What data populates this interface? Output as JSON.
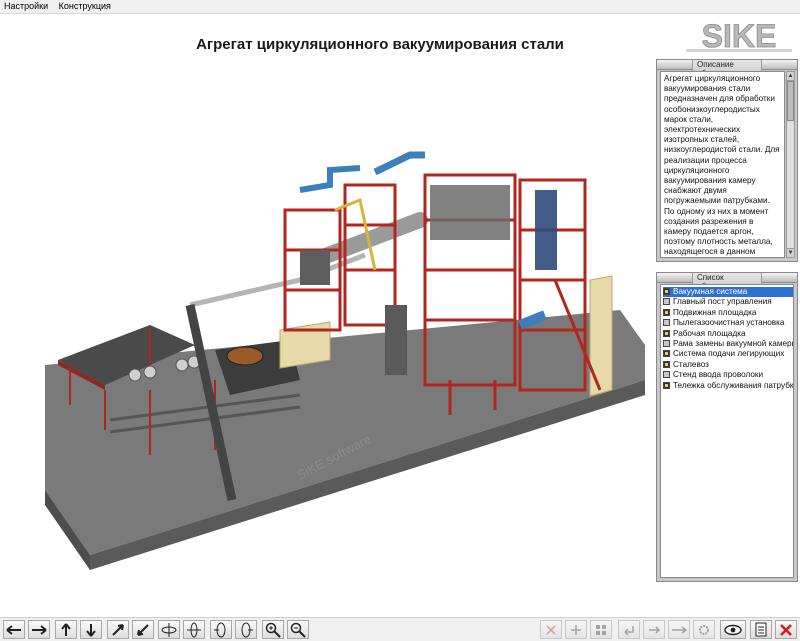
{
  "menu": {
    "items": [
      "Настройки",
      "Конструкция"
    ]
  },
  "header": {
    "title": "Агрегат циркуляционного вакуумирования стали",
    "logo_text": "SIKE"
  },
  "watermark": "SiKE software",
  "description_panel": {
    "title": "Описание объекта",
    "text": "Агрегат циркуляционного вакуумирования стали предназначен для обработки особонизкоуглеродистых марок стали, электротехнических изотропных сталей, низкоуглеродистой стали. Для реализации процесса циркуляционного вакуумирования камеру снабжают двумя погружаемыми патрубками. По одному из них в момент создания разрежения в камеру подается аргон, поэтому плотность металла, находящегося в данном патрубке, снижается, что"
  },
  "objects_panel": {
    "title": "Список объектов",
    "items": [
      {
        "label": "Вакуумная система",
        "state": "on",
        "selected": true
      },
      {
        "label": "Главный пост управления",
        "state": "off",
        "selected": false
      },
      {
        "label": "Подвижная площадка",
        "state": "on",
        "selected": false
      },
      {
        "label": "Пылегазоочистная установка",
        "state": "off",
        "selected": false
      },
      {
        "label": "Рабочая площадка",
        "state": "on",
        "selected": false
      },
      {
        "label": "Рама замены вакуумной камеры",
        "state": "off",
        "selected": false
      },
      {
        "label": "Система подачи легирующих",
        "state": "on",
        "selected": false
      },
      {
        "label": "Сталевоз",
        "state": "on",
        "selected": false
      },
      {
        "label": "Стенд ввода проволоки",
        "state": "off",
        "selected": false
      },
      {
        "label": "Тележка обслуживания патрубков",
        "state": "on",
        "selected": false
      }
    ]
  },
  "toolbar": {
    "left_buttons": [
      "arrow-left-icon",
      "arrow-right-icon",
      "arrow-up-icon",
      "arrow-down-icon",
      "pan-up-right-icon",
      "pan-down-left-icon",
      "rotate-horizontal-icon",
      "rotate-vertical-icon",
      "rotate-left-icon",
      "rotate-right-icon",
      "zoom-in-icon",
      "zoom-out-icon"
    ],
    "right_buttons": [
      "disassemble-icon",
      "assemble-icon",
      "grid-icon",
      "undo-icon",
      "redo-icon",
      "arrows-icon",
      "settings-icon",
      "view-eye-icon",
      "document-icon",
      "close-icon"
    ]
  },
  "colors": {
    "accent": "#2f6fd0",
    "frame_red": "#b3261e",
    "floor": "#6e6e6e",
    "close_red": "#d11f1f"
  }
}
